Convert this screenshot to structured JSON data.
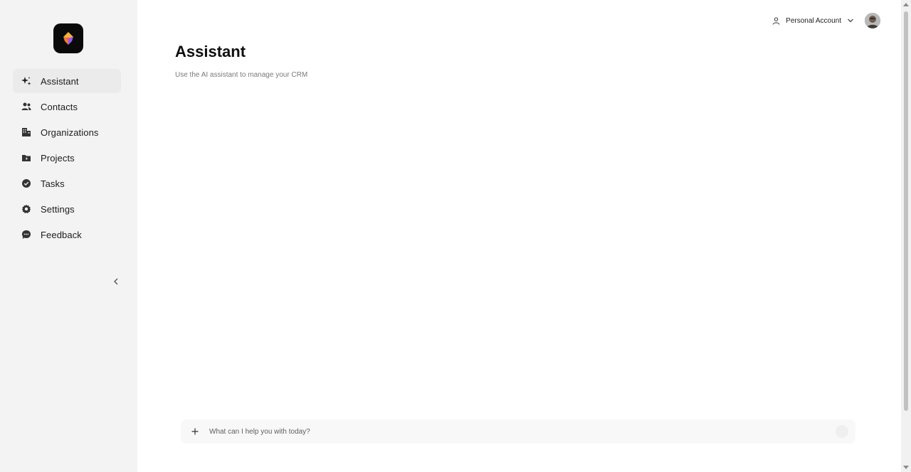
{
  "sidebar": {
    "logo_icon": "app-logo-icon",
    "items": [
      {
        "label": "Assistant",
        "icon": "sparkles-icon",
        "active": true
      },
      {
        "label": "Contacts",
        "icon": "users-icon",
        "active": false
      },
      {
        "label": "Organizations",
        "icon": "building-icon",
        "active": false
      },
      {
        "label": "Projects",
        "icon": "folder-icon",
        "active": false
      },
      {
        "label": "Tasks",
        "icon": "check-circle-icon",
        "active": false
      },
      {
        "label": "Settings",
        "icon": "gear-icon",
        "active": false
      },
      {
        "label": "Feedback",
        "icon": "chat-bubble-icon",
        "active": false
      }
    ],
    "collapse_icon": "chevron-left-icon"
  },
  "header": {
    "account_label": "Personal Account",
    "account_icon": "user-icon",
    "dropdown_icon": "chevron-down-icon",
    "avatar_icon": "avatar"
  },
  "main": {
    "title": "Assistant",
    "subtitle": "Use the AI assistant to manage your CRM"
  },
  "composer": {
    "placeholder": "What can I help you with today?",
    "plus_icon": "plus-icon",
    "send_icon": "send-icon"
  },
  "colors": {
    "sidebar_bg": "#f3f3f3",
    "active_item_bg": "#ebebeb",
    "logo_bg": "#0a0a0a",
    "logo_accent_orange": "#f07a2b",
    "logo_accent_purple": "#8b5cf6"
  }
}
